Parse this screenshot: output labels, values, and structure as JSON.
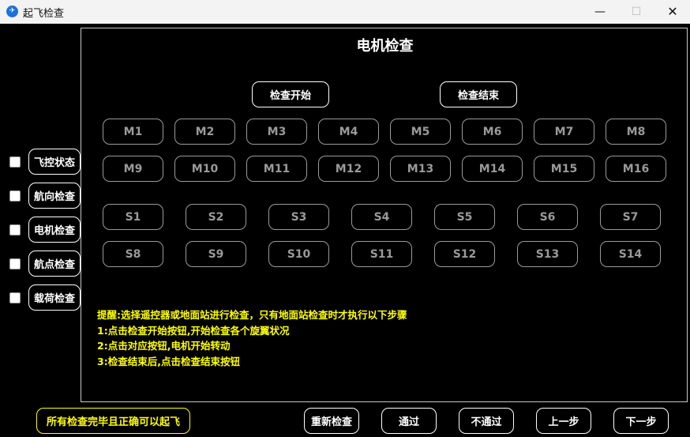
{
  "window": {
    "title": "起飞检查",
    "minimize": "—",
    "maximize": "☐",
    "close": "✕"
  },
  "panel": {
    "title": "电机检查",
    "start_label": "检查开始",
    "end_label": "检查结束"
  },
  "motors_row1": [
    "M1",
    "M2",
    "M3",
    "M4",
    "M5",
    "M6",
    "M7",
    "M8"
  ],
  "motors_row2": [
    "M9",
    "M10",
    "M11",
    "M12",
    "M13",
    "M14",
    "M15",
    "M16"
  ],
  "servos_row1": [
    "S1",
    "S2",
    "S3",
    "S4",
    "S5",
    "S6",
    "S7"
  ],
  "servos_row2": [
    "S8",
    "S9",
    "S10",
    "S11",
    "S12",
    "S13",
    "S14"
  ],
  "sidebar": {
    "items": [
      {
        "label": "飞控状态",
        "checked": false
      },
      {
        "label": "航向检查",
        "checked": false
      },
      {
        "label": "电机检查",
        "checked": false
      },
      {
        "label": "航点检查",
        "checked": false
      },
      {
        "label": "载荷检查",
        "checked": false
      }
    ]
  },
  "notes": [
    "提醒:选择遥控器或地面站进行检查，只有地面站检查时才执行以下步骤",
    "1:点击检查开始按钮,开始检查各个旋翼状况",
    "2:点击对应按钮,电机开始转动",
    "3:检查结束后,点击检查结束按钮"
  ],
  "status": "所有检查完毕且正确可以起飞",
  "footer": {
    "recheck": "重新检查",
    "pass": "通过",
    "fail": "不通过",
    "prev": "上一步",
    "next": "下一步"
  },
  "colors": {
    "background": "#000000",
    "highlight": "#ffff00",
    "button_border": "#ffffff",
    "disabled": "#9a9a9a"
  }
}
